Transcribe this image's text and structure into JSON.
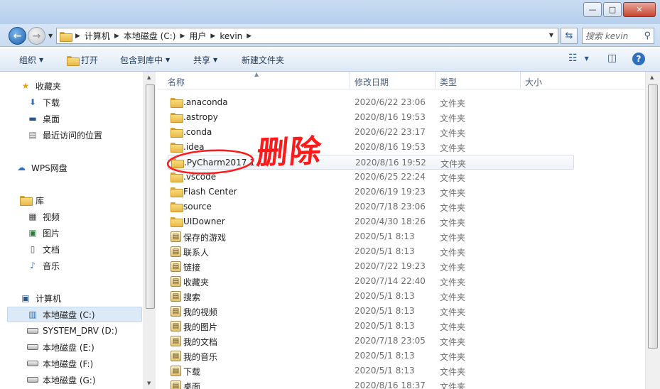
{
  "window": {
    "title": ""
  },
  "window_controls": {
    "minimize": "—",
    "maximize": "□",
    "close": "✕"
  },
  "address": {
    "crumbs": [
      "计算机",
      "本地磁盘 (C:)",
      "用户",
      "kevin"
    ],
    "search_placeholder": "搜索 kevin"
  },
  "toolbar": {
    "organize": "组织",
    "open": "打开",
    "include_in_library": "包含到库中",
    "share": "共享",
    "new_folder": "新建文件夹"
  },
  "sidebar": {
    "favorites": {
      "label": "收藏夹",
      "items": [
        "下载",
        "桌面",
        "最近访问的位置"
      ]
    },
    "wps": {
      "label": "WPS网盘"
    },
    "libraries": {
      "label": "库",
      "items": [
        "视频",
        "图片",
        "文档",
        "音乐"
      ]
    },
    "computer": {
      "label": "计算机",
      "drives": [
        "本地磁盘 (C:)",
        "SYSTEM_DRV (D:)",
        "本地磁盘 (E:)",
        "本地磁盘 (F:)",
        "本地磁盘 (G:)"
      ]
    }
  },
  "columns": {
    "name": "名称",
    "date": "修改日期",
    "type": "类型",
    "size": "大小"
  },
  "files": [
    {
      "name": ".anaconda",
      "date": "2020/6/22 23:06",
      "type": "文件夹"
    },
    {
      "name": ".astropy",
      "date": "2020/8/16 19:53",
      "type": "文件夹"
    },
    {
      "name": ".conda",
      "date": "2020/6/22 23:17",
      "type": "文件夹"
    },
    {
      "name": ".idea",
      "date": "2020/8/16 19:53",
      "type": "文件夹"
    },
    {
      "name": ".PyCharm2017.1",
      "date": "2020/8/16 19:52",
      "type": "文件夹"
    },
    {
      "name": ".vscode",
      "date": "2020/6/25 22:24",
      "type": "文件夹"
    },
    {
      "name": "Flash Center",
      "date": "2020/6/19 19:23",
      "type": "文件夹"
    },
    {
      "name": "source",
      "date": "2020/7/18 23:06",
      "type": "文件夹"
    },
    {
      "name": "UIDowner",
      "date": "2020/4/30 18:26",
      "type": "文件夹"
    },
    {
      "name": "保存的游戏",
      "date": "2020/5/1 8:13",
      "type": "文件夹"
    },
    {
      "name": "联系人",
      "date": "2020/5/1 8:13",
      "type": "文件夹"
    },
    {
      "name": "链接",
      "date": "2020/7/22 19:23",
      "type": "文件夹"
    },
    {
      "name": "收藏夹",
      "date": "2020/7/14 22:40",
      "type": "文件夹"
    },
    {
      "name": "搜索",
      "date": "2020/5/1 8:13",
      "type": "文件夹"
    },
    {
      "name": "我的视频",
      "date": "2020/5/1 8:13",
      "type": "文件夹"
    },
    {
      "name": "我的图片",
      "date": "2020/5/1 8:13",
      "type": "文件夹"
    },
    {
      "name": "我的文档",
      "date": "2020/7/18 23:05",
      "type": "文件夹"
    },
    {
      "name": "我的音乐",
      "date": "2020/5/1 8:13",
      "type": "文件夹"
    },
    {
      "name": "下载",
      "date": "2020/5/1 8:13",
      "type": "文件夹"
    },
    {
      "name": "桌面",
      "date": "2020/8/16 18:37",
      "type": "文件夹"
    }
  ],
  "annotation": {
    "text": "删除",
    "color": "#ff1a1a"
  },
  "colors": {
    "accent": "#1e395b",
    "selection": "#dce9f7"
  }
}
